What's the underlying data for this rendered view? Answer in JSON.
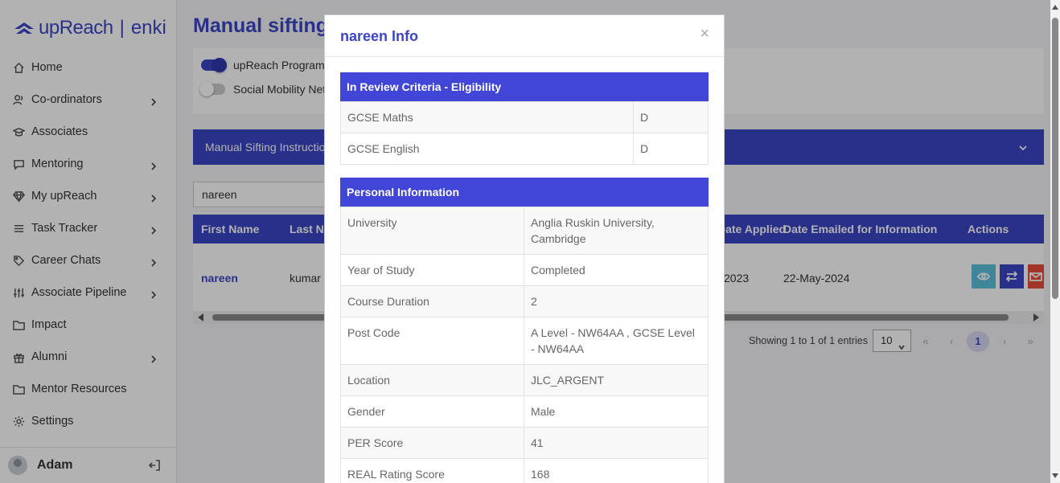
{
  "sidebar": {
    "brand": "upReach",
    "brand_sep": "|",
    "product": "enki",
    "items": [
      {
        "label": "Home",
        "icon": "home-icon",
        "has_children": false
      },
      {
        "label": "Co-ordinators",
        "icon": "coordinators-icon",
        "has_children": true
      },
      {
        "label": "Associates",
        "icon": "graduation-cap-icon",
        "has_children": false
      },
      {
        "label": "Mentoring",
        "icon": "chat-icon",
        "has_children": true
      },
      {
        "label": "My upReach",
        "icon": "diamond-icon",
        "has_children": true
      },
      {
        "label": "Task Tracker",
        "icon": "list-icon",
        "has_children": true
      },
      {
        "label": "Career Chats",
        "icon": "tag-icon",
        "has_children": true
      },
      {
        "label": "Associate Pipeline",
        "icon": "sliders-icon",
        "has_children": true
      },
      {
        "label": "Impact",
        "icon": "folder-icon",
        "has_children": false
      },
      {
        "label": "Alumni",
        "icon": "gift-icon",
        "has_children": true
      },
      {
        "label": "Mentor Resources",
        "icon": "folder-icon",
        "has_children": false
      },
      {
        "label": "Settings",
        "icon": "gear-icon",
        "has_children": false
      }
    ],
    "user_name": "Adam"
  },
  "main": {
    "title": "Manual sifting",
    "toggles": [
      {
        "label": "upReach Programme",
        "on": true
      },
      {
        "label": "Social Mobility Network",
        "on": false
      }
    ],
    "instructions_label": "Manual Sifting Instructions",
    "search_value": "nareen",
    "table": {
      "headers": [
        "First Name",
        "Last Name",
        "Date Applied",
        "Date Emailed for Information",
        "Actions"
      ],
      "rows": [
        {
          "first_name": "nareen",
          "last_name": "kumar",
          "date_applied": "2023",
          "date_emailed": "22-May-2024"
        }
      ]
    },
    "entries_text": "Showing 1 to 1 of 1 entries",
    "page_size": "10",
    "current_page": "1",
    "colors": {
      "accent": "#3b45c6",
      "modal_header": "#4146d8",
      "view_button": "#5bc0de",
      "delete_button": "#e74c3c"
    }
  },
  "modal": {
    "title": "nareen Info",
    "close_symbol": "×",
    "eligibility": {
      "title": "In Review Criteria - Eligibility",
      "rows": [
        {
          "label": "GCSE Maths",
          "value": "D"
        },
        {
          "label": "GCSE English",
          "value": "D"
        }
      ]
    },
    "personal": {
      "title": "Personal Information",
      "rows": [
        {
          "label": "University",
          "value": "Anglia Ruskin University, Cambridge"
        },
        {
          "label": "Year of Study",
          "value": "Completed"
        },
        {
          "label": "Course Duration",
          "value": "2"
        },
        {
          "label": "Post Code",
          "value": "A Level - NW64AA , GCSE Level - NW64AA"
        },
        {
          "label": "Location",
          "value": "JLC_ARGENT"
        },
        {
          "label": "Gender",
          "value": "Male"
        },
        {
          "label": "PER Score",
          "value": "41"
        },
        {
          "label": "REAL Rating Score",
          "value": "168"
        }
      ]
    }
  }
}
